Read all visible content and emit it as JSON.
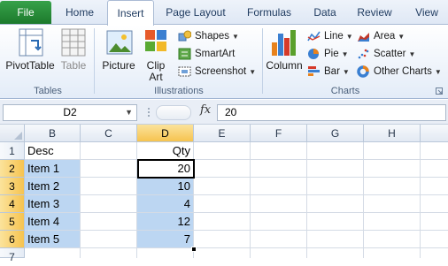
{
  "tabs": {
    "file": "File",
    "home": "Home",
    "insert": "Insert",
    "page_layout": "Page Layout",
    "formulas": "Formulas",
    "data": "Data",
    "review": "Review",
    "view": "View"
  },
  "ribbon": {
    "tables": {
      "pivot_table": "PivotTable",
      "table": "Table",
      "label": "Tables"
    },
    "illustrations": {
      "picture": "Picture",
      "clip_art_line1": "Clip",
      "clip_art_line2": "Art",
      "shapes": "Shapes",
      "smartart": "SmartArt",
      "screenshot": "Screenshot",
      "label": "Illustrations"
    },
    "charts": {
      "column": "Column",
      "line": "Line",
      "pie": "Pie",
      "bar": "Bar",
      "area": "Area",
      "scatter": "Scatter",
      "other_charts": "Other Charts",
      "label": "Charts"
    }
  },
  "formula_bar": {
    "name_box": "D2",
    "fx": "fx",
    "value": "20"
  },
  "sheet": {
    "columns": [
      "B",
      "C",
      "D",
      "E",
      "F",
      "G",
      "H"
    ],
    "rows": [
      "1",
      "2",
      "3",
      "4",
      "5",
      "6",
      "7"
    ],
    "cells": {
      "B1": "Desc",
      "D1": "Qty",
      "B2": "Item 1",
      "D2": "20",
      "B3": "Item 2",
      "D3": "10",
      "B4": "Item 3",
      "D4": "4",
      "B5": "Item 4",
      "D5": "12",
      "B6": "Item 5",
      "D6": "7"
    }
  },
  "colors": {
    "file_tab": "#1f7a31",
    "selection": "#bcd6f2",
    "header_selected": "#f6c34f"
  }
}
